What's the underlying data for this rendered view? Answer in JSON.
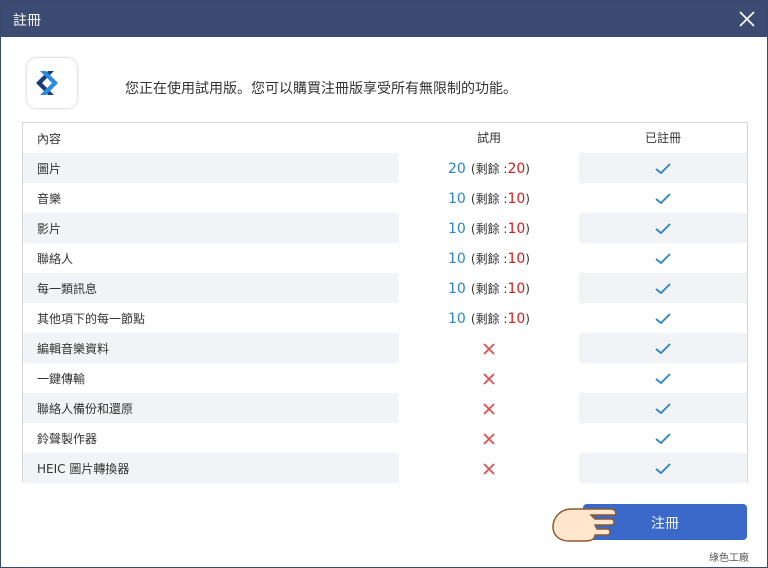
{
  "window": {
    "title": "註冊",
    "close_icon": "close-icon"
  },
  "app": {
    "logo_icon": "app-logo-icon"
  },
  "intro_text": "您正在使用試用版。您可以購買注冊版享受所有無限制的功能。",
  "table": {
    "headers": {
      "content": "內容",
      "trial": "試用",
      "registered": "已註冊"
    },
    "rows": [
      {
        "name": "圖片",
        "trial_value": "20",
        "trial_remaining_label": "(剩餘 :",
        "trial_remaining": "20",
        "trial_close": ")",
        "trial_allowed": true,
        "registered_check": "check-icon"
      },
      {
        "name": "音樂",
        "trial_value": "10",
        "trial_remaining_label": "(剩餘 :",
        "trial_remaining": "10",
        "trial_close": ")",
        "trial_allowed": true,
        "registered_check": "check-icon"
      },
      {
        "name": "影片",
        "trial_value": "10",
        "trial_remaining_label": "(剩餘 :",
        "trial_remaining": "10",
        "trial_close": ")",
        "trial_allowed": true,
        "registered_check": "check-icon"
      },
      {
        "name": "聯絡人",
        "trial_value": "10",
        "trial_remaining_label": "(剩餘 :",
        "trial_remaining": "10",
        "trial_close": ")",
        "trial_allowed": true,
        "registered_check": "check-icon"
      },
      {
        "name": "每一類訊息",
        "trial_value": "10",
        "trial_remaining_label": "(剩餘 :",
        "trial_remaining": "10",
        "trial_close": ")",
        "trial_allowed": true,
        "registered_check": "check-icon"
      },
      {
        "name": "其他項下的每一節點",
        "trial_value": "10",
        "trial_remaining_label": "(剩餘 :",
        "trial_remaining": "10",
        "trial_close": ")",
        "trial_allowed": true,
        "registered_check": "check-icon"
      },
      {
        "name": "編輯音樂資料",
        "trial_allowed": false,
        "trial_icon": "cross-icon",
        "registered_check": "check-icon"
      },
      {
        "name": "一鍵傳輸",
        "trial_allowed": false,
        "trial_icon": "cross-icon",
        "registered_check": "check-icon"
      },
      {
        "name": "聯絡人備份和還原",
        "trial_allowed": false,
        "trial_icon": "cross-icon",
        "registered_check": "check-icon"
      },
      {
        "name": "鈴聲製作器",
        "trial_allowed": false,
        "trial_icon": "cross-icon",
        "registered_check": "check-icon"
      },
      {
        "name": "HEIC 圖片轉換器",
        "trial_allowed": false,
        "trial_icon": "cross-icon",
        "registered_check": "check-icon"
      }
    ]
  },
  "register_button": {
    "label": "注冊"
  },
  "pointer": {
    "icon": "hand-pointer-icon"
  },
  "watermark": {
    "text": "綠色工廠"
  },
  "colors": {
    "titlebar": "#3b4b72",
    "accent": "#3a69c9",
    "check": "#2a86c6",
    "cross": "#e05050",
    "trial_text": "#2a86c6",
    "remaining_text": "#d02020"
  }
}
